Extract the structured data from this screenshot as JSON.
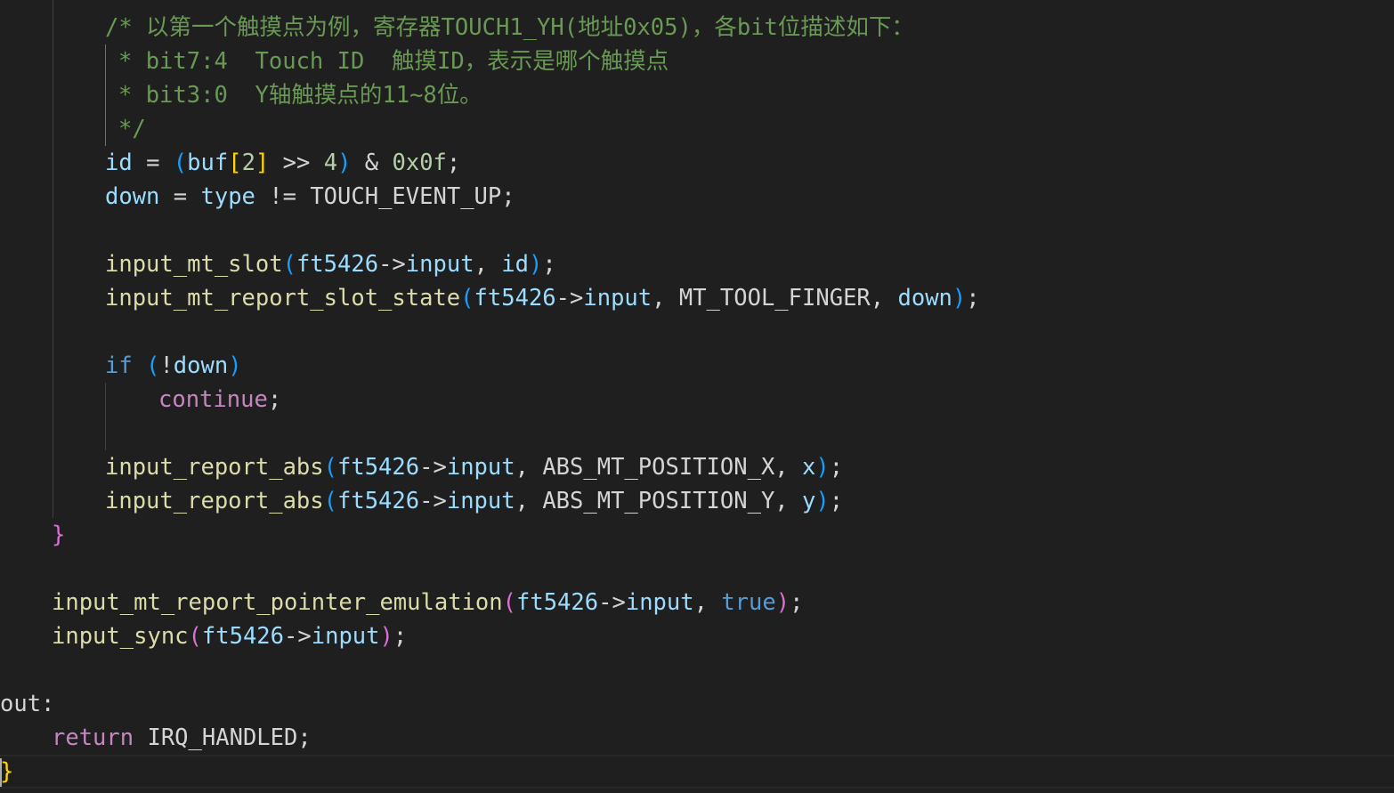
{
  "colors": {
    "background": "#1f1f1f",
    "comment": "#6a9955",
    "function": "#dcdcaa",
    "variable": "#9cdcfe",
    "keyword": "#569cd6",
    "control": "#c586c0",
    "number": "#b5cea8",
    "text": "#d4d4d4",
    "bracket1": "#ffd700",
    "bracket2": "#da70d6",
    "bracket3": "#179fff"
  },
  "lines": [
    [
      [
        "c",
        "/* 以第一个触摸点为例，寄存器TOUCH1_YH(地址0x05)，各bit位描述如下："
      ]
    ],
    [
      [
        "c",
        "* bit7:4  Touch ID  触摸ID，表示是哪个触摸点"
      ]
    ],
    [
      [
        "c",
        "* bit3:0  Y轴触摸点的11~8位。"
      ]
    ],
    [
      [
        "c",
        "*/"
      ]
    ],
    [
      [
        "v",
        "id"
      ],
      [
        "t",
        " = "
      ],
      [
        "b3",
        "("
      ],
      [
        "v",
        "buf"
      ],
      [
        "b1",
        "["
      ],
      [
        "n",
        "2"
      ],
      [
        "b1",
        "]"
      ],
      [
        "t",
        " >> "
      ],
      [
        "n",
        "4"
      ],
      [
        "b3",
        ")"
      ],
      [
        "t",
        " & "
      ],
      [
        "n",
        "0x0f"
      ],
      [
        "t",
        ";"
      ]
    ],
    [
      [
        "v",
        "down"
      ],
      [
        "t",
        " = "
      ],
      [
        "v",
        "type"
      ],
      [
        "t",
        " != TOUCH_EVENT_UP;"
      ]
    ],
    [],
    [
      [
        "f",
        "input_mt_slot"
      ],
      [
        "b3",
        "("
      ],
      [
        "v",
        "ft5426"
      ],
      [
        "t",
        "->"
      ],
      [
        "v",
        "input"
      ],
      [
        "t",
        ", "
      ],
      [
        "v",
        "id"
      ],
      [
        "b3",
        ")"
      ],
      [
        "t",
        ";"
      ]
    ],
    [
      [
        "f",
        "input_mt_report_slot_state"
      ],
      [
        "b3",
        "("
      ],
      [
        "v",
        "ft5426"
      ],
      [
        "t",
        "->"
      ],
      [
        "v",
        "input"
      ],
      [
        "t",
        ", MT_TOOL_FINGER, "
      ],
      [
        "v",
        "down"
      ],
      [
        "b3",
        ")"
      ],
      [
        "t",
        ";"
      ]
    ],
    [],
    [
      [
        "k",
        "if"
      ],
      [
        "t",
        " "
      ],
      [
        "b3",
        "("
      ],
      [
        "t",
        "!"
      ],
      [
        "v",
        "down"
      ],
      [
        "b3",
        ")"
      ]
    ],
    [
      [
        "p",
        "continue"
      ],
      [
        "t",
        ";"
      ]
    ],
    [],
    [
      [
        "f",
        "input_report_abs"
      ],
      [
        "b3",
        "("
      ],
      [
        "v",
        "ft5426"
      ],
      [
        "t",
        "->"
      ],
      [
        "v",
        "input"
      ],
      [
        "t",
        ", ABS_MT_POSITION_X, "
      ],
      [
        "v",
        "x"
      ],
      [
        "b3",
        ")"
      ],
      [
        "t",
        ";"
      ]
    ],
    [
      [
        "f",
        "input_report_abs"
      ],
      [
        "b3",
        "("
      ],
      [
        "v",
        "ft5426"
      ],
      [
        "t",
        "->"
      ],
      [
        "v",
        "input"
      ],
      [
        "t",
        ", ABS_MT_POSITION_Y, "
      ],
      [
        "v",
        "y"
      ],
      [
        "b3",
        ")"
      ],
      [
        "t",
        ";"
      ]
    ],
    [
      [
        "b2",
        "}"
      ]
    ],
    [],
    [
      [
        "f",
        "input_mt_report_pointer_emulation"
      ],
      [
        "b2",
        "("
      ],
      [
        "v",
        "ft5426"
      ],
      [
        "t",
        "->"
      ],
      [
        "v",
        "input"
      ],
      [
        "t",
        ", "
      ],
      [
        "k",
        "true"
      ],
      [
        "b2",
        ")"
      ],
      [
        "t",
        ";"
      ]
    ],
    [
      [
        "f",
        "input_sync"
      ],
      [
        "b2",
        "("
      ],
      [
        "v",
        "ft5426"
      ],
      [
        "t",
        "->"
      ],
      [
        "v",
        "input"
      ],
      [
        "b2",
        ")"
      ],
      [
        "t",
        ";"
      ]
    ],
    [],
    [
      [
        "t",
        "out:"
      ]
    ],
    [
      [
        "p",
        "return"
      ],
      [
        "t",
        " IRQ_HANDLED;"
      ]
    ],
    [
      [
        "b1",
        "}"
      ]
    ]
  ]
}
